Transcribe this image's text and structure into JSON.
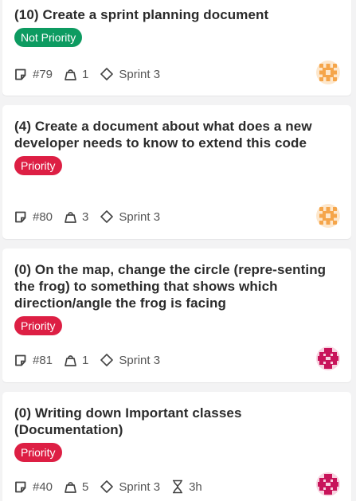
{
  "cards": [
    {
      "title": "(10) Create a sprint planning document",
      "priority_label": "Not Priority",
      "priority_color": "#0d9b61",
      "issue_id": "#79",
      "weight": "1",
      "sprint": "Sprint 3",
      "avatar_color": "#f5a54a"
    },
    {
      "title": "(4) Create a document about what does a new developer needs to know to extend this code",
      "priority_label": "Priority",
      "priority_color": "#dd1f44",
      "issue_id": "#80",
      "weight": "3",
      "sprint": "Sprint 3",
      "avatar_color": "#f5a54a"
    },
    {
      "title": "(0) On the map, change the circle (repre-senting the frog) to something that shows which direction/angle the frog is facing",
      "priority_label": "Priority",
      "priority_color": "#dd1f44",
      "issue_id": "#81",
      "weight": "1",
      "sprint": "Sprint 3",
      "avatar_color": "#c8145a"
    },
    {
      "title": "(0) Writing down Important classes (Documentation)",
      "priority_label": "Priority",
      "priority_color": "#dd1f44",
      "issue_id": "#40",
      "weight": "5",
      "sprint": "Sprint 3",
      "time_estimate": "3h",
      "avatar_color": "#c8145a"
    }
  ]
}
